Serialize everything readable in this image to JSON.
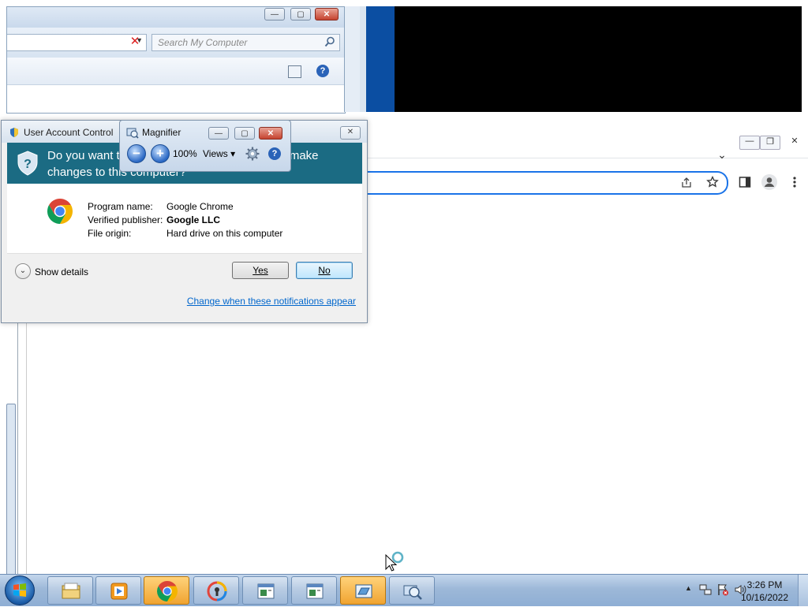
{
  "explorer": {
    "search_placeholder": "Search My Computer",
    "buttons": {
      "minimize": "—",
      "maximize": "▢",
      "close": "✕"
    }
  },
  "chrome_window": {
    "tab_dropdown": "⌄"
  },
  "uac": {
    "title": "User Account Control",
    "question": "Do you want to allow the following program to make changes to this computer?",
    "fields": [
      {
        "label": "Program name:",
        "value": "Google Chrome",
        "bold": false
      },
      {
        "label": "Verified publisher:",
        "value": "Google LLC",
        "bold": true
      },
      {
        "label": "File origin:",
        "value": "Hard drive on this computer",
        "bold": false
      }
    ],
    "show_details": "Show details",
    "yes_label": "Yes",
    "no_label": "No",
    "change_link": "Change when these notifications appear",
    "close_glyph": "✕"
  },
  "magnifier": {
    "title": "Magnifier",
    "zoom_out": "−",
    "zoom_in": "+",
    "zoom_level": "100%",
    "views_label": "Views ▾",
    "help": "?"
  },
  "taskbar": {
    "items": [
      "windows-explorer",
      "media-player",
      "google-chrome",
      "keepass",
      "app-window",
      "app-window-2",
      "control-panel",
      "magnifier"
    ],
    "clock_time": "3:26 PM",
    "clock_date": "10/16/2022",
    "tray_chevron": "▲"
  },
  "colors": {
    "uac_banner": "#1b6b83",
    "chrome_focus": "#1a73e8",
    "taskbar": "#9db8d8"
  }
}
